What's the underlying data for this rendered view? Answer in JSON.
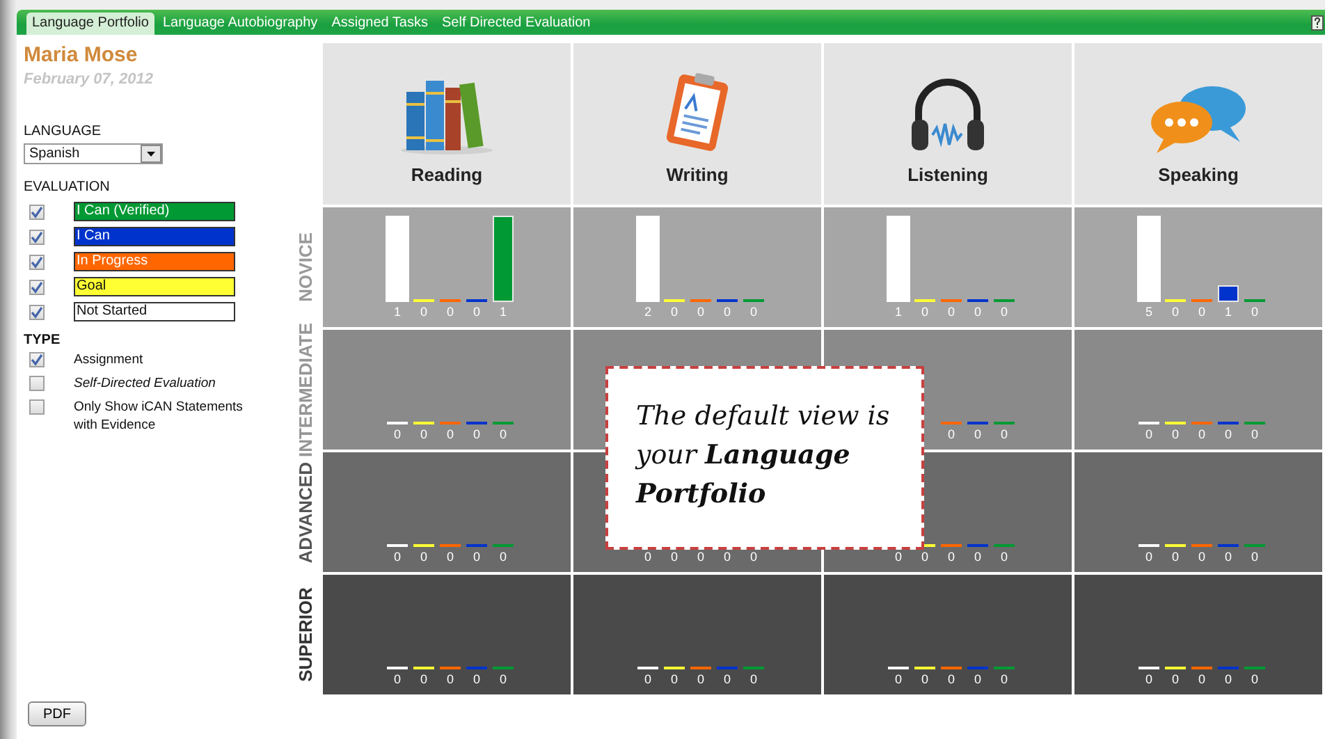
{
  "tabs": [
    {
      "label": "Language Portfolio",
      "selected": true
    },
    {
      "label": "Language Autobiography",
      "selected": false
    },
    {
      "label": "Assigned Tasks",
      "selected": false
    },
    {
      "label": "Self Directed Evaluation",
      "selected": false
    }
  ],
  "user": {
    "name": "Maria Mose",
    "date": "February 07, 2012"
  },
  "language": {
    "label": "LANGUAGE",
    "value": "Spanish"
  },
  "evaluation": {
    "heading": "EVALUATION",
    "items": [
      {
        "label": "I Can (Verified)",
        "checked": true,
        "color": "#009933"
      },
      {
        "label": "I Can",
        "checked": true,
        "color": "#0033cc"
      },
      {
        "label": "In Progress",
        "checked": true,
        "color": "#ff6600"
      },
      {
        "label": "Goal",
        "checked": true,
        "color": "#ffff33"
      },
      {
        "label": "Not Started",
        "checked": true,
        "color": "#ffffff"
      }
    ]
  },
  "type": {
    "heading": "TYPE",
    "items": [
      {
        "label": "Assignment",
        "checked": true,
        "italic": false
      },
      {
        "label": "Self-Directed Evaluation",
        "checked": false,
        "italic": true
      },
      {
        "label": "Only Show iCAN Statements with Evidence",
        "checked": false,
        "italic": false
      }
    ]
  },
  "skills": [
    {
      "label": "Reading",
      "kind": "books"
    },
    {
      "label": "Writing",
      "kind": "clipboard"
    },
    {
      "label": "Listening",
      "kind": "headphones"
    },
    {
      "label": "Speaking",
      "kind": "bubbles"
    }
  ],
  "levels": [
    {
      "label": "NOVICE",
      "cells": [
        {
          "bars": [
            {
              "count": "1"
            },
            {
              "count": "0"
            },
            {
              "count": "0"
            },
            {
              "count": "0"
            },
            {
              "count": "1"
            }
          ]
        },
        {
          "bars": [
            {
              "count": "2"
            },
            {
              "count": "0"
            },
            {
              "count": "0"
            },
            {
              "count": "0"
            },
            {
              "count": "0"
            }
          ]
        },
        {
          "bars": [
            {
              "count": "1"
            },
            {
              "count": "0"
            },
            {
              "count": "0"
            },
            {
              "count": "0"
            },
            {
              "count": "0"
            }
          ]
        },
        {
          "bars": [
            {
              "count": "5"
            },
            {
              "count": "0"
            },
            {
              "count": "0"
            },
            {
              "count": "1"
            },
            {
              "count": "0"
            }
          ]
        }
      ]
    },
    {
      "label": "INTERMEDIATE",
      "cells": [
        {
          "bars": [
            {
              "count": "0"
            },
            {
              "count": "0"
            },
            {
              "count": "0"
            },
            {
              "count": "0"
            },
            {
              "count": "0"
            }
          ]
        },
        {},
        {
          "bars": [
            {
              "count": "0"
            },
            {
              "count": "0"
            },
            {
              "count": "0"
            }
          ]
        },
        {
          "bars": [
            {
              "count": "0"
            },
            {
              "count": "0"
            },
            {
              "count": "0"
            },
            {
              "count": "0"
            },
            {
              "count": "0"
            }
          ]
        }
      ]
    },
    {
      "label": "ADVANCED",
      "cells": [
        {
          "bars": [
            {
              "count": "0"
            },
            {
              "count": "0"
            },
            {
              "count": "0"
            },
            {
              "count": "0"
            },
            {
              "count": "0"
            }
          ]
        },
        {
          "bars": [
            {
              "count": "0"
            },
            {
              "count": "0"
            },
            {
              "count": "0"
            },
            {
              "count": "0"
            },
            {
              "count": "0"
            }
          ]
        },
        {
          "bars": [
            {
              "count": "0"
            },
            {
              "count": "0"
            },
            {
              "count": "0"
            },
            {
              "count": "0"
            },
            {
              "count": "0"
            }
          ]
        },
        {
          "bars": [
            {
              "count": "0"
            },
            {
              "count": "0"
            },
            {
              "count": "0"
            },
            {
              "count": "0"
            },
            {
              "count": "0"
            }
          ]
        }
      ]
    },
    {
      "label": "SUPERIOR",
      "cells": [
        {
          "bars": [
            {
              "count": "0"
            },
            {
              "count": "0"
            },
            {
              "count": "0"
            },
            {
              "count": "0"
            },
            {
              "count": "0"
            }
          ]
        },
        {
          "bars": [
            {
              "count": "0"
            },
            {
              "count": "0"
            },
            {
              "count": "0"
            },
            {
              "count": "0"
            },
            {
              "count": "0"
            }
          ]
        },
        {
          "bars": [
            {
              "count": "0"
            },
            {
              "count": "0"
            },
            {
              "count": "0"
            },
            {
              "count": "0"
            },
            {
              "count": "0"
            }
          ]
        },
        {
          "bars": [
            {
              "count": "0"
            },
            {
              "count": "0"
            },
            {
              "count": "0"
            },
            {
              "count": "0"
            },
            {
              "count": "0"
            }
          ]
        }
      ]
    }
  ],
  "callout": {
    "text": "The default view is your **Language Portfolio**"
  },
  "pdf_button": "PDF"
}
